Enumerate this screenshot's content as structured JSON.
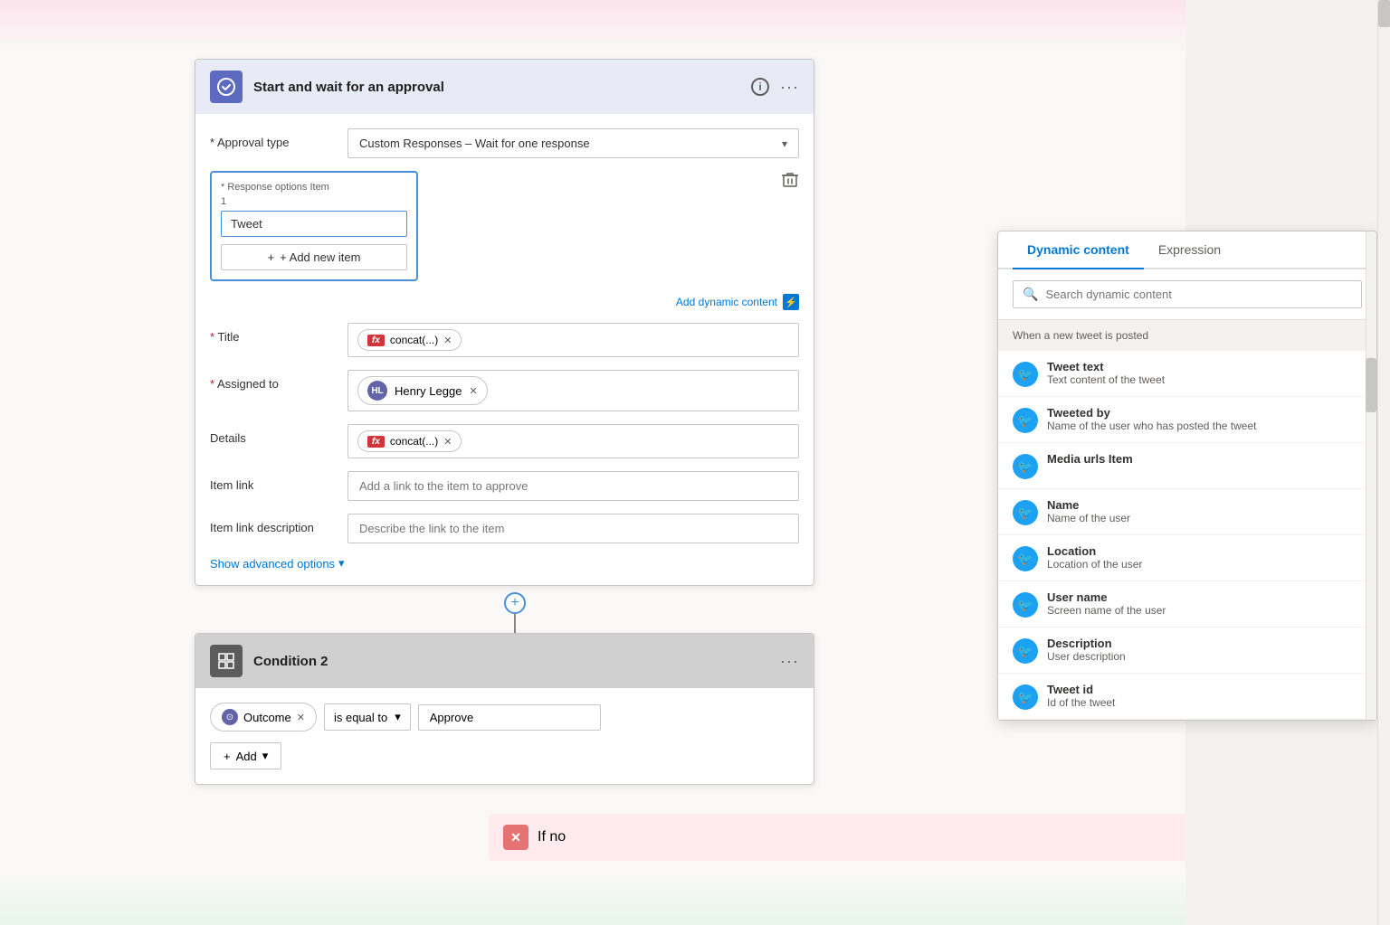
{
  "canvas": {
    "bg": "#faf9f8"
  },
  "approvalCard": {
    "title": "Start and wait for an approval",
    "approvalTypeLabel": "* Approval type",
    "approvalTypeValue": "Custom Responses – Wait for one response",
    "responseOptionsLabel": "* Response options Item",
    "responseItemNumber": "1",
    "responseItemValue": "Tweet",
    "addNewItemLabel": "+ Add new item",
    "titleLabel": "* Title",
    "titleTokenLabel": "concat(...)",
    "assignedToLabel": "* Assigned to",
    "assignedToName": "Henry Legge",
    "assignedToInitials": "HL",
    "detailsLabel": "Details",
    "detailsTokenLabel": "concat(...)",
    "itemLinkLabel": "Item link",
    "itemLinkPlaceholder": "Add a link to the item to approve",
    "itemLinkDescLabel": "Item link description",
    "itemLinkDescPlaceholder": "Describe the link to the item",
    "addDynamicContentLabel": "Add dynamic content",
    "showAdvancedLabel": "Show advanced options"
  },
  "conditionCard": {
    "title": "Condition 2",
    "outcomeLabel": "Outcome",
    "isEqualToLabel": "is equal to",
    "approveLabel": "Approve",
    "addLabel": "+ Add"
  },
  "ifNoStrip": {
    "label": "If no"
  },
  "dynamicPanel": {
    "tabs": [
      {
        "label": "Dynamic content",
        "active": true
      },
      {
        "label": "Expression",
        "active": false
      }
    ],
    "searchPlaceholder": "Search dynamic content",
    "sectionHeader": "When a new tweet is posted",
    "items": [
      {
        "name": "Tweet text",
        "desc": "Text content of the tweet"
      },
      {
        "name": "Tweeted by",
        "desc": "Name of the user who has posted the tweet"
      },
      {
        "name": "Media urls Item",
        "desc": ""
      },
      {
        "name": "Name",
        "desc": "Name of the user"
      },
      {
        "name": "Location",
        "desc": "Location of the user"
      },
      {
        "name": "User name",
        "desc": "Screen name of the user"
      },
      {
        "name": "Description",
        "desc": "User description"
      },
      {
        "name": "Tweet id",
        "desc": "Id of the tweet"
      }
    ]
  }
}
